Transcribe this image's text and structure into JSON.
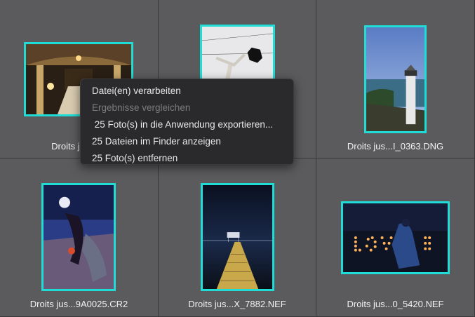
{
  "grid": {
    "cells": [
      {
        "caption": "Droits jusq...c"
      },
      {
        "caption": ""
      },
      {
        "caption": "Droits jus...I_0363.DNG"
      },
      {
        "caption": "Droits jus...9A0025.CR2"
      },
      {
        "caption": "Droits jus...X_7882.NEF"
      },
      {
        "caption": "Droits jus...0_5420.NEF"
      }
    ]
  },
  "context_menu": {
    "items": [
      {
        "label": "Datei(en) verarbeiten",
        "enabled": true
      },
      {
        "label": "Ergebnisse vergleichen",
        "enabled": false
      },
      {
        "label": " 25 Foto(s) in die Anwendung exportieren...",
        "enabled": true
      },
      {
        "label": "25 Dateien im Finder anzeigen",
        "enabled": true
      },
      {
        "label": "25 Foto(s) entfernen",
        "enabled": true
      }
    ]
  },
  "colors": {
    "selection_border": "#1fdcd6",
    "background": "#5b5b5d",
    "menu_background": "#2a2a2c"
  }
}
